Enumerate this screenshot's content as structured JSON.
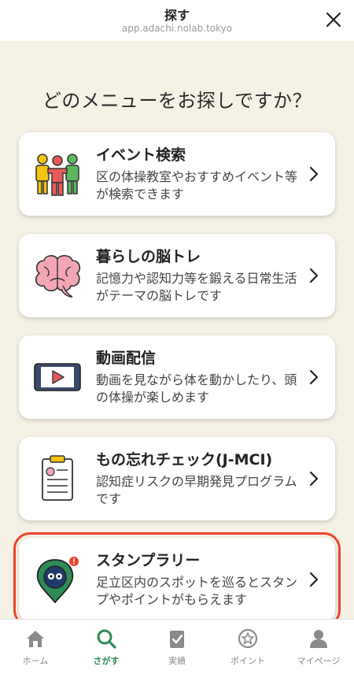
{
  "header": {
    "title": "探す",
    "url": "app.adachi.nolab.tokyo"
  },
  "heading": "どのメニューをお探しですか？",
  "cards": [
    {
      "title": "イベント検索",
      "desc": "区の体操教室やおすすめイベント等が検索できます",
      "icon": "people-icon"
    },
    {
      "title": "暮らしの脳トレ",
      "desc": "記憶力や認知力等を鍛える日常生活がテーマの脳トレです",
      "icon": "brain-icon"
    },
    {
      "title": "動画配信",
      "desc": "動画を見ながら体を動かしたり、頭の体操が楽しめます",
      "icon": "video-play-icon"
    },
    {
      "title": "もの忘れチェック(J-MCI)",
      "desc": "認知症リスクの早期発見プログラムです",
      "icon": "clipboard-icon"
    },
    {
      "title": "スタンプラリー",
      "desc": "足立区内のスポットを巡るとスタンプやポイントがもらえます",
      "icon": "map-pin-mascot-icon"
    }
  ],
  "nav": [
    {
      "label": "ホーム",
      "icon": "home-icon"
    },
    {
      "label": "さがす",
      "icon": "search-icon"
    },
    {
      "label": "実績",
      "icon": "record-icon"
    },
    {
      "label": "ポイント",
      "icon": "point-star-icon"
    },
    {
      "label": "マイページ",
      "icon": "user-icon"
    }
  ],
  "colors": {
    "background": "#f5f1e5",
    "accent_green": "#2e8b57",
    "highlight_red": "#e8462d"
  }
}
